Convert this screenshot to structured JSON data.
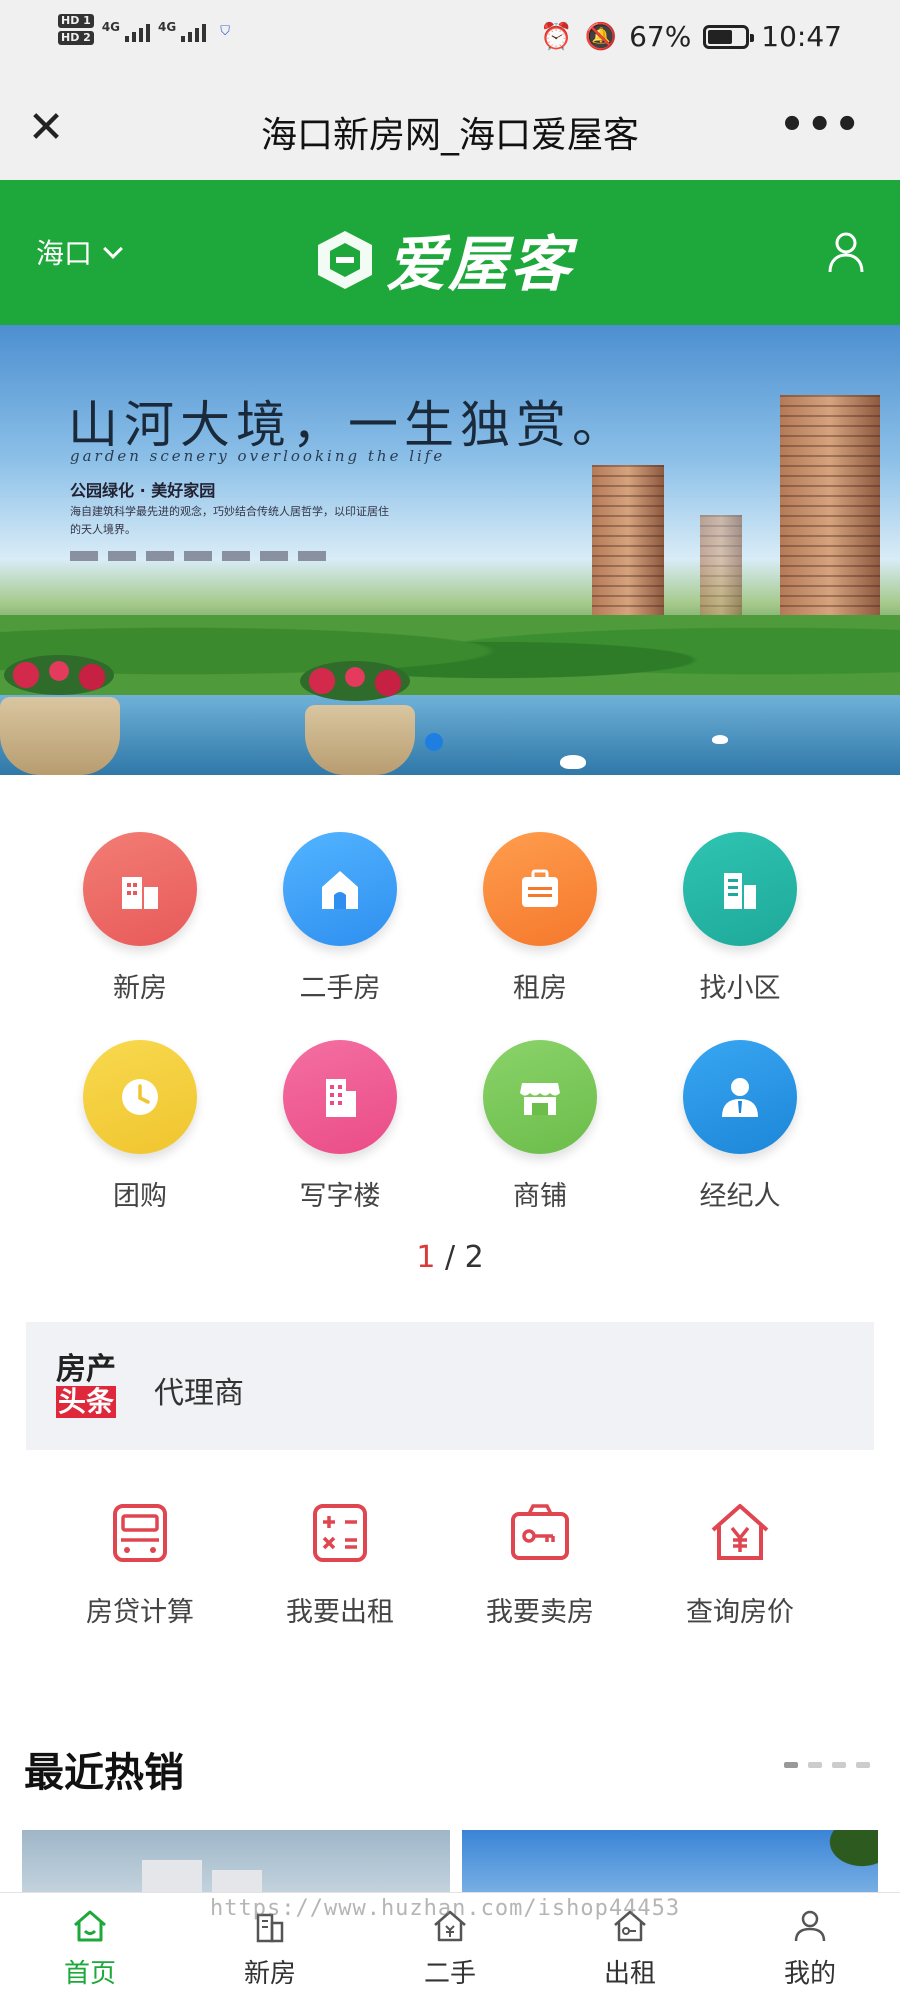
{
  "status_bar": {
    "hd1": "HD 1",
    "hd2": "HD 2",
    "net1": "4G",
    "net2": "4G",
    "battery_percent": "67%",
    "battery_level": 0.67,
    "time": "10:47",
    "icons": [
      "alarm-icon",
      "mute-icon",
      "battery-icon"
    ]
  },
  "title_bar": {
    "title": "海口新房网_海口爱屋客",
    "close_icon": "close-icon",
    "more_icon": "more-icon"
  },
  "header": {
    "city": "海口",
    "logo_text": "爱屋客",
    "brand_color": "#1ea83b",
    "user_icon": "user-icon"
  },
  "banner": {
    "headline": "山河大境，一生独赏。",
    "subtitle_en": "garden scenery overlooking the life",
    "sub": "公园绿化 · 美好家园",
    "desc": "海自建筑科学最先进的观念，巧妙结合传统人居哲学，以印证居住的天人境界。",
    "active_slide": 1,
    "slide_dot_color": "#1f7fe0"
  },
  "categories": [
    {
      "label": "新房",
      "icon": "building-icon",
      "color_from": "#f27d74",
      "color_to": "#e85a5a"
    },
    {
      "label": "二手房",
      "icon": "house-icon",
      "color_from": "#52b4ff",
      "color_to": "#2f8ff0"
    },
    {
      "label": "租房",
      "icon": "briefcase-icon",
      "color_from": "#ff9d4e",
      "color_to": "#f5782c"
    },
    {
      "label": "找小区",
      "icon": "community-icon",
      "color_from": "#2fc4b2",
      "color_to": "#1ea99a"
    },
    {
      "label": "团购",
      "icon": "clock-icon",
      "color_from": "#f8d94e",
      "color_to": "#f0c52f"
    },
    {
      "label": "写字楼",
      "icon": "office-icon",
      "color_from": "#f46fa2",
      "color_to": "#ea4c86"
    },
    {
      "label": "商铺",
      "icon": "shop-icon",
      "color_from": "#8ad36a",
      "color_to": "#6cbd4a"
    },
    {
      "label": "经纪人",
      "icon": "agent-icon",
      "color_from": "#38a6f2",
      "color_to": "#1d86d8"
    }
  ],
  "category_pager": {
    "current": "1",
    "total": "/ 2"
  },
  "news": {
    "badge_top": "房产",
    "badge_bottom": "头条",
    "text": "代理商"
  },
  "tools": [
    {
      "label": "房贷计算",
      "icon": "calculator-icon"
    },
    {
      "label": "我要出租",
      "icon": "calc-grid-icon"
    },
    {
      "label": "我要卖房",
      "icon": "key-card-icon"
    },
    {
      "label": "查询房价",
      "icon": "house-price-icon"
    }
  ],
  "tool_color": "#e04650",
  "hot": {
    "title": "最近热销",
    "page_count": 4,
    "active_page": 1
  },
  "watermark": "https://www.huzhan.com/ishop44453",
  "bottom_nav": [
    {
      "label": "首页",
      "icon": "home-icon",
      "active": true
    },
    {
      "label": "新房",
      "icon": "building-icon",
      "active": false
    },
    {
      "label": "二手",
      "icon": "house-icon",
      "active": false
    },
    {
      "label": "出租",
      "icon": "rent-icon",
      "active": false
    },
    {
      "label": "我的",
      "icon": "user-icon",
      "active": false
    }
  ]
}
